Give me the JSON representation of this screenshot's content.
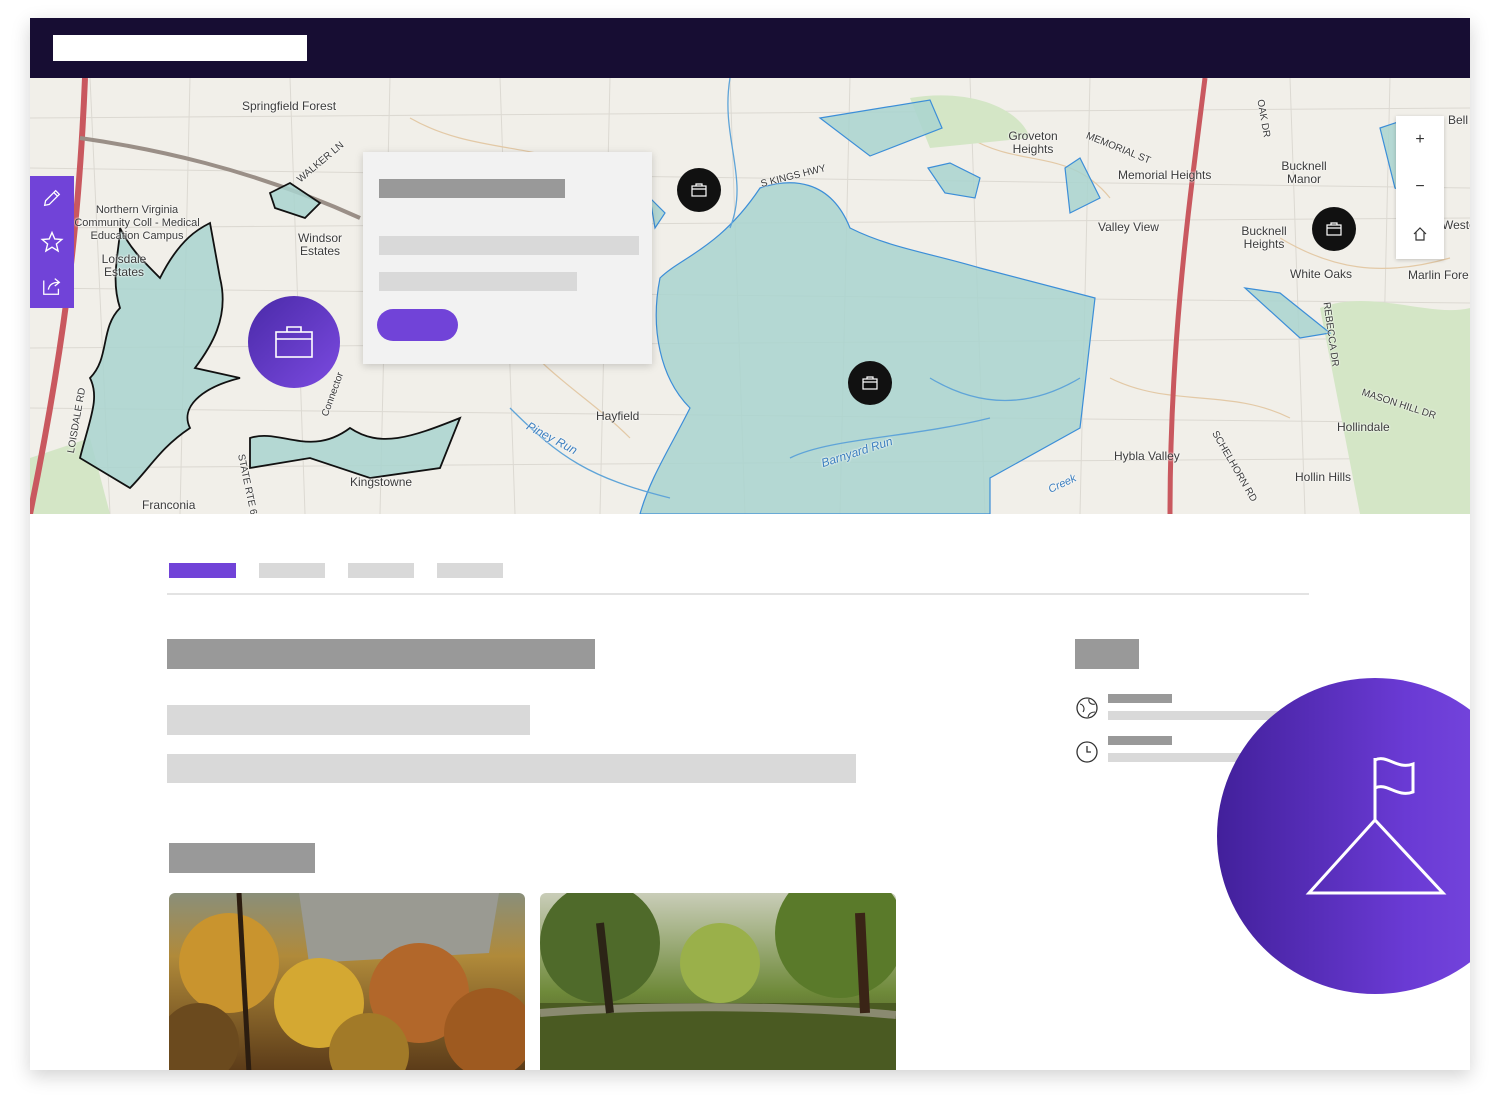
{
  "colors": {
    "topbar": "#170d33",
    "accent": "#7143d8",
    "placeholder_dark": "#999999",
    "placeholder_light": "#d9d9d9",
    "park_fill": "#a9d3cf",
    "park_stroke": "#3c8ed8"
  },
  "map": {
    "labels": [
      "Springfield Forest",
      "Northern Virginia Community Coll - Medical Education Campus",
      "Loisdale Estates",
      "Windsor Estates",
      "Franconia",
      "Kingstowne",
      "Hayfield",
      "Groveton Heights",
      "Memorial Heights",
      "Valley View",
      "Bucknell Manor",
      "Bucknell Heights",
      "White Oaks",
      "Marlin Fore",
      "Hollindale",
      "Hybla Valley",
      "Hollin Hills",
      "Bell",
      "Westo",
      "Piney Run",
      "Barnyard Run",
      "S KINGS HWY",
      "WALKER LN",
      "MEMORIAL ST",
      "OAK DR",
      "REBECCA DR",
      "MASON HILL DR",
      "SCHELHORN RD",
      "LOISDALE RD",
      "STATE RTE 6",
      "Connector",
      "Creek"
    ],
    "tools": [
      "pencil-icon",
      "star-icon",
      "share-icon"
    ],
    "zoom": {
      "in": "+",
      "out": "−"
    }
  },
  "markers": [
    "briefcase-icon",
    "briefcase-icon",
    "briefcase-icon",
    "briefcase-icon"
  ],
  "info_icons": [
    "globe-icon",
    "clock-icon"
  ],
  "feature_icon": "mountain-flag-icon"
}
